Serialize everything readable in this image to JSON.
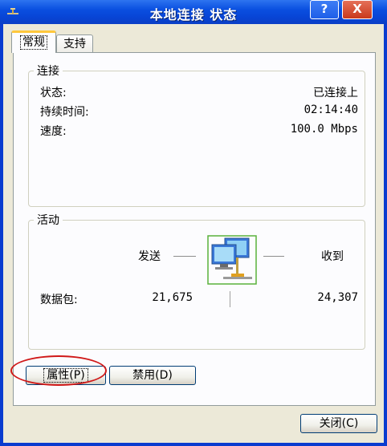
{
  "window": {
    "title": "本地连接 状态",
    "help_button": "?",
    "close_button": "X",
    "colors": {
      "titlebar": "#0a4fe0",
      "client_bg": "#ece9d8",
      "highlight": "#d01818"
    }
  },
  "tabs": [
    {
      "label": "常规",
      "selected": true
    },
    {
      "label": "支持",
      "selected": false
    }
  ],
  "connection": {
    "title": "连接",
    "rows": [
      {
        "label": "状态:",
        "value": "已连接上"
      },
      {
        "label": "持续时间:",
        "value": "02:14:40"
      },
      {
        "label": "速度:",
        "value": "100.0 Mbps"
      }
    ]
  },
  "activity": {
    "title": "活动",
    "sent_label": "发送",
    "received_label": "收到",
    "packets_label": "数据包:",
    "packets_sent": "21,675",
    "packets_received": "24,307",
    "icon": "network-computers-icon"
  },
  "buttons": {
    "properties": "属性(P)",
    "disable": "禁用(D)",
    "close": "关闭(C)"
  }
}
